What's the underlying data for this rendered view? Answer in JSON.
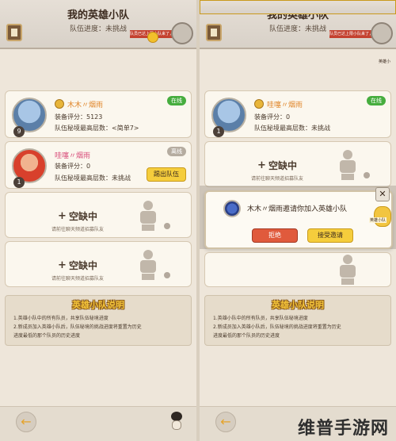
{
  "header": {
    "title": "我的英雄小队",
    "subtitle": "队伍进度：未挑战",
    "notice": "队员已达上限小队来了，通关后还能获得额外奖励"
  },
  "left": {
    "members": [
      {
        "name": "木木〃烟雨",
        "status": "在线",
        "gear_score": "装备评分：5123",
        "progress": "队伍秘境最高层数：<简单7>",
        "level": "9"
      },
      {
        "name": "哇噻〃烟雨",
        "status": "离线",
        "gear_score": "装备评分：0",
        "progress": "队伍秘境最高层数：未挑战",
        "level": "1",
        "kick_label": "踢出队伍"
      }
    ],
    "empty_slots": [
      {
        "title": "空缺中",
        "subtitle": "请前往聊天频道招募队友"
      },
      {
        "title": "空缺中",
        "subtitle": "请前往聊天频道招募队友"
      }
    ]
  },
  "right": {
    "member": {
      "name": "哇噻〃烟雨",
      "status": "在线",
      "gear_score": "装备评分：0",
      "progress": "队伍秘境最高层数：未挑战",
      "level": "1"
    },
    "empty_slot": {
      "title": "空缺中",
      "subtitle": "请前往聊天频道招募队友"
    },
    "invite": {
      "text": "木木〃烟雨邀请你加入英雄小队",
      "reject": "拒绝",
      "accept": "接受邀请",
      "close": "✕",
      "mascot_label": "英雄小队"
    },
    "bubble_label": "英雄小"
  },
  "rules": {
    "title": "英雄小队说明",
    "lines": [
      "1.英雄小队中的所有队员，共享队伍秘境进度",
      "2.新成员加入英雄小队后，队伍秘境的挑战进度将重置为历史",
      "进度最低的那个队员的历史进度"
    ]
  },
  "footer": {
    "back": "←"
  },
  "watermark": "维普手游网",
  "colors": {
    "online": "#46ad3e",
    "offline": "#b5aca0",
    "accent_yellow": "#f5cd3c",
    "reject_red": "#e05a3c",
    "name_orange": "#e0862a",
    "name_pink": "#d84d7a"
  }
}
